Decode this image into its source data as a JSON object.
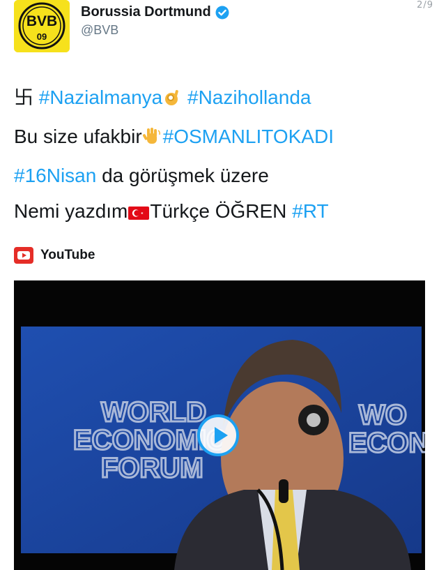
{
  "page": {
    "counter": "2/9"
  },
  "account": {
    "display_name": "Borussia Dortmund",
    "handle": "@BVB",
    "avatar_text_top": "BVB",
    "avatar_text_bottom": "09",
    "verified_icon": "verified-badge-icon"
  },
  "tweet": {
    "line1": {
      "symbol": "卐",
      "hashtag1": "#Nazialmanya",
      "emoji": "ok-hand-emoji",
      "hashtag2": "#Nazihollanda"
    },
    "line2": {
      "text": "Bu size ufakbir",
      "emoji": "waving-hand-emoji",
      "hashtag": "#OSMANLITOKADI"
    },
    "line3": {
      "hashtag": "#16Nisan",
      "text": " da görüşmek üzere"
    },
    "line4": {
      "text1": "Nemi yazdım",
      "emoji": "turkish-flag-emoji",
      "text2": "Türkçe ÖĞREN ",
      "hashtag": "#RT"
    }
  },
  "media": {
    "source_label": "YouTube",
    "source_icon": "youtube-icon",
    "play_icon": "play-icon",
    "video_logo_text": [
      "WORLD",
      "ECONOMIC",
      "FORUM"
    ]
  },
  "colors": {
    "brand_yellow": "#f6e11c",
    "link_blue": "#1da1f2",
    "handle_gray": "#657786",
    "youtube_red": "#e52d27"
  }
}
